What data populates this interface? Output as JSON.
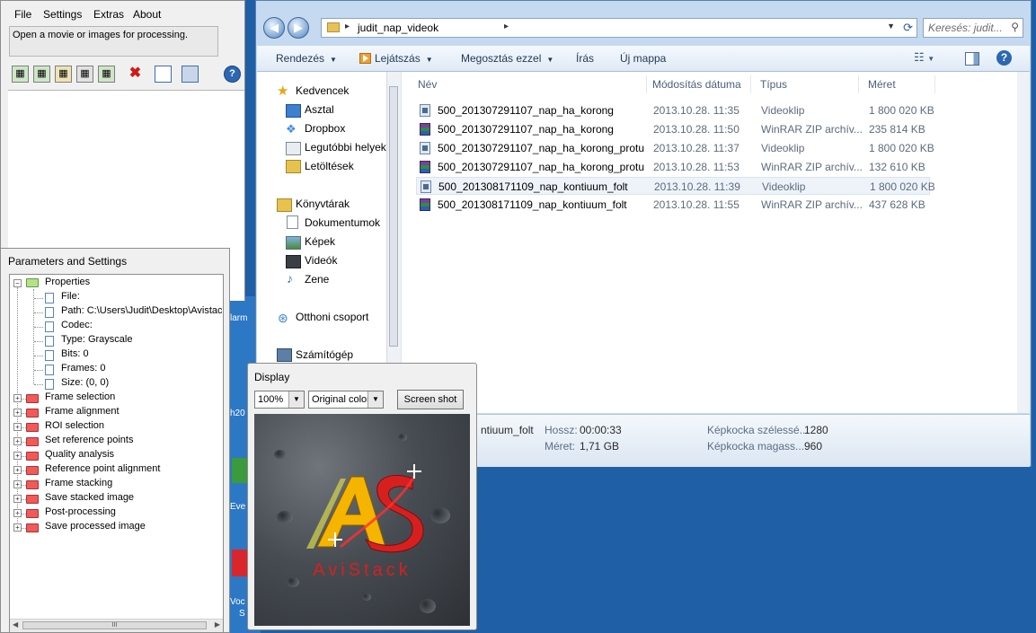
{
  "explorer": {
    "address_path": "judit_nap_videok",
    "search_placeholder": "Keresés: judit...",
    "toolbar": {
      "organize": "Rendezés",
      "play": "Lejátszás",
      "share": "Megosztás ezzel",
      "burn": "Írás",
      "new_folder": "Új mappa"
    },
    "nav": {
      "favorites": "Kedvencek",
      "desktop": "Asztal",
      "dropbox": "Dropbox",
      "recent": "Legutóbbi helyek",
      "downloads": "Letöltések",
      "libraries": "Könyvtárak",
      "documents": "Dokumentumok",
      "pictures": "Képek",
      "videos": "Videók",
      "music": "Zene",
      "homegroup": "Otthoni csoport",
      "computer": "Számítógép"
    },
    "columns": {
      "name": "Név",
      "modified": "Módosítás dátuma",
      "type": "Típus",
      "size": "Méret"
    },
    "files": [
      {
        "name": "500_201307291107_nap_ha_korong",
        "modified": "2013.10.28. 11:35",
        "type": "Videoklip",
        "size": "1 800 020 KB",
        "icon": "video"
      },
      {
        "name": "500_201307291107_nap_ha_korong",
        "modified": "2013.10.28. 11:50",
        "type": "WinRAR ZIP archív...",
        "size": "235 814 KB",
        "icon": "rar"
      },
      {
        "name": "500_201307291107_nap_ha_korong_protu",
        "modified": "2013.10.28. 11:37",
        "type": "Videoklip",
        "size": "1 800 020 KB",
        "icon": "video"
      },
      {
        "name": "500_201307291107_nap_ha_korong_protu",
        "modified": "2013.10.28. 11:53",
        "type": "WinRAR ZIP archív...",
        "size": "132 610 KB",
        "icon": "rar"
      },
      {
        "name": "500_201308171109_nap_kontiuum_folt",
        "modified": "2013.10.28. 11:39",
        "type": "Videoklip",
        "size": "1 800 020 KB",
        "icon": "video"
      },
      {
        "name": "500_201308171109_nap_kontiuum_folt",
        "modified": "2013.10.28. 11:55",
        "type": "WinRAR ZIP archív...",
        "size": "437 628 KB",
        "icon": "rar"
      }
    ],
    "details": {
      "name_fragment": "ntiuum_folt",
      "length_label": "Hossz:",
      "length_value": "00:00:33",
      "size_label": "Méret:",
      "size_value": "1,71 GB",
      "width_label": "Képkocka szélessé...",
      "width_value": "1280",
      "height_label": "Képkocka magass...",
      "height_value": "960"
    }
  },
  "avistack": {
    "menu": [
      "File",
      "Settings",
      "Extras",
      "About"
    ],
    "status": "Open a movie or images for processing.",
    "tools": [
      "open-movie-icon",
      "open-images-icon",
      "load-icon",
      "save-settings-icon",
      "export-icon",
      "close-x-icon",
      "new-doc-icon",
      "save-disk-icon",
      "help-icon"
    ]
  },
  "params": {
    "title": "Parameters and Settings",
    "root": "Properties",
    "properties": [
      "File:",
      "Path: C:\\Users\\Judit\\Desktop\\Avistac",
      "Codec:",
      "Type: Grayscale",
      "Bits: 0",
      "Frames: 0",
      "Size: (0, 0)"
    ],
    "sections": [
      "Frame selection",
      "Frame alignment",
      "ROI selection",
      "Set reference points",
      "Quality analysis",
      "Reference point alignment",
      "Frame stacking",
      "Save stacked image",
      "Post-processing",
      "Save processed image"
    ],
    "scroll_grip": "III"
  },
  "display": {
    "title": "Display",
    "zoom": "100%",
    "color_mode": "Original color",
    "screenshot": "Screen shot",
    "logo_text": "AviStack"
  },
  "desktop": {
    "labels": [
      "larm",
      "h20",
      "Eve",
      "Voc",
      "S"
    ]
  },
  "colors": {
    "desktop_blue": "#1f5fa6",
    "explorer_frame": "#c5daf0",
    "logo_red": "#d62020",
    "logo_yellow": "#f4b400"
  }
}
